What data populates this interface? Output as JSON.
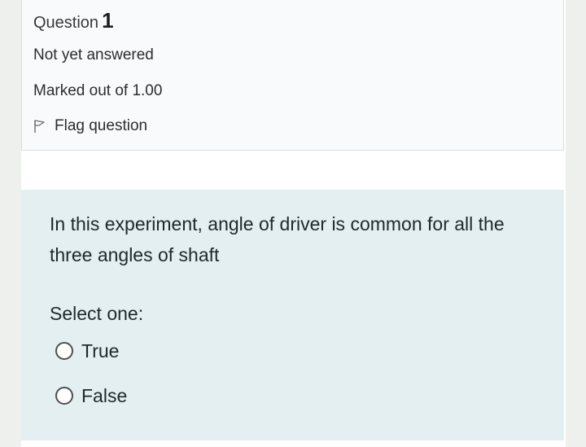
{
  "question_info": {
    "heading_label": "Question",
    "number": "1",
    "state": "Not yet answered",
    "grade": "Marked out of 1.00",
    "flag_label": "Flag question"
  },
  "question": {
    "text": "In this experiment, angle of driver is common for all the three angles of shaft",
    "prompt": "Select one:",
    "options": [
      {
        "label": "True",
        "selected": false
      },
      {
        "label": "False",
        "selected": false
      }
    ]
  },
  "colors": {
    "info_background": "#f8fafb",
    "question_background": "#e3eff0",
    "text": "#1d2a2d"
  },
  "icons": {
    "flag": "flag-outline-icon",
    "radio": "radio-unchecked-icon"
  }
}
